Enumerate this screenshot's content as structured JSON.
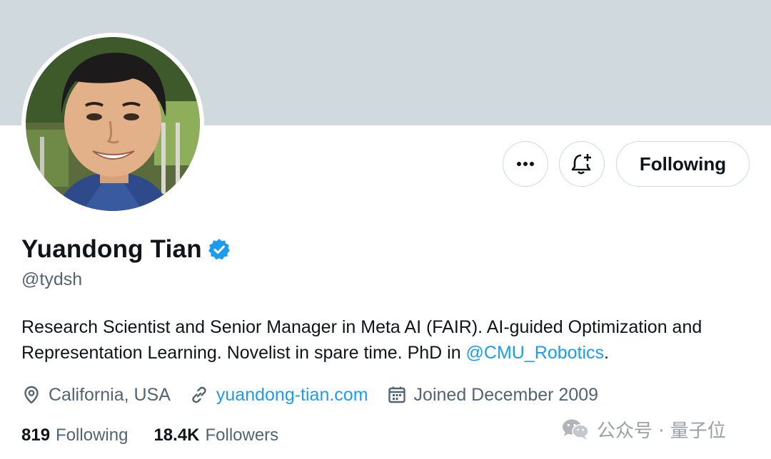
{
  "profile": {
    "display_name": "Yuandong Tian",
    "handle": "@tydsh",
    "verified": true,
    "bio_text": "Research Scientist and Senior Manager in Meta AI (FAIR). AI-guided Optimization and Representation Learning. Novelist in spare time. PhD in ",
    "bio_mention": "@CMU_Robotics",
    "bio_suffix": ".",
    "location": "California, USA",
    "website": "yuandong-tian.com",
    "joined": "Joined December 2009"
  },
  "actions": {
    "more_icon": "more-icon",
    "notify_icon": "bell-plus-icon",
    "following_label": "Following"
  },
  "stats": {
    "following_count": "819",
    "following_label": "Following",
    "followers_count": "18.4K",
    "followers_label": "Followers"
  },
  "watermark": {
    "text": "公众号 · 量子位",
    "icon": "wechat-icon"
  },
  "colors": {
    "banner": "#cfd9de",
    "accent": "#1d9bf0",
    "secondary_text": "#536471",
    "primary_text": "#0f1419"
  }
}
